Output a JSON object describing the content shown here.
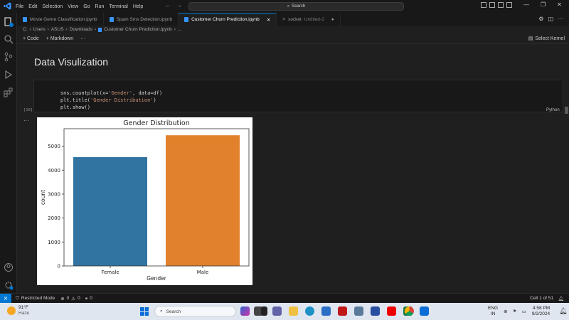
{
  "menu": [
    "File",
    "Edit",
    "Selection",
    "View",
    "Go",
    "Run",
    "Terminal",
    "Help"
  ],
  "command_center": {
    "label": "Search"
  },
  "tabs": [
    {
      "label": "Movie Genre Classification.ipynb",
      "active": false
    },
    {
      "label": "Spam Sms Detection.ipynb",
      "active": false
    },
    {
      "label": "Customer Churn Prediction.ipynb",
      "active": true
    },
    {
      "label": "socket",
      "sub": "Untitled-2",
      "active": false
    }
  ],
  "breadcrumb": [
    "C:",
    "Users",
    "ASUS",
    "Downloads",
    "Customer Churn Prediction.ipynb",
    "..."
  ],
  "toolbar": {
    "code": "Code",
    "markdown": "Markdown",
    "more": "···",
    "kernel": "Select Kernel"
  },
  "notebook": {
    "heading": "Data Visulization",
    "code_lines": [
      "sns.countplot(x='Gender', data=df)",
      "plt.title('Gender Distribution')",
      "plt.show()"
    ],
    "exec_count": "[18]",
    "language": "Python",
    "output_ellipsis": "···"
  },
  "chart_data": {
    "type": "bar",
    "title": "Gender Distribution",
    "xlabel": "Gender",
    "ylabel": "count",
    "categories": [
      "Female",
      "Male"
    ],
    "values": [
      4543,
      5457
    ],
    "colors": [
      "#3274a1",
      "#e1812c"
    ],
    "ylim": [
      0,
      5730
    ],
    "yticks": [
      0,
      1000,
      2000,
      3000,
      4000,
      5000
    ],
    "grid": false
  },
  "statusbar": {
    "mode": "Restricted Mode",
    "errors": "0",
    "warnings": "0",
    "ports": "0",
    "cell": "Cell 1 of 51"
  },
  "taskbar": {
    "weather_temp": "91°F",
    "weather_desc": "Haze",
    "search": "Search",
    "lang1": "ENG",
    "lang2": "IN",
    "time": "4:58 PM",
    "date": "9/2/2024"
  }
}
